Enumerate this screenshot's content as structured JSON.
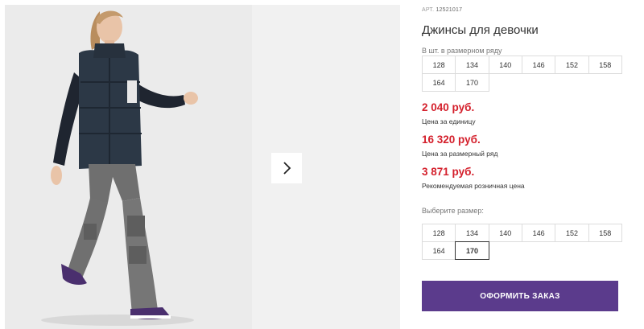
{
  "product": {
    "art_label": "АРТ.",
    "art_code": "12521017",
    "title": "Джинсы для девочки"
  },
  "pack": {
    "caption": "В шт. в размерном ряду",
    "sizes": [
      "128",
      "134",
      "140",
      "146",
      "152",
      "158",
      "164",
      "170"
    ]
  },
  "prices": {
    "unit_price": "2 040 руб.",
    "unit_label": "Цена за единицу",
    "row_price": "16 320 руб.",
    "row_label": "Цена за размерный ряд",
    "retail_price": "3 871 руб.",
    "retail_label": "Рекомендуемая розничная цена"
  },
  "size_picker": {
    "caption": "Выберите размер:",
    "sizes": [
      "128",
      "134",
      "140",
      "146",
      "152",
      "158",
      "164",
      "170"
    ],
    "selected": "170"
  },
  "order_button": {
    "label": "ОФОРМИТЬ ЗАКАЗ"
  },
  "colors": {
    "price": "#d4202c",
    "button": "#5b3b8c"
  },
  "icons": {
    "next": "chevron-right-icon"
  }
}
